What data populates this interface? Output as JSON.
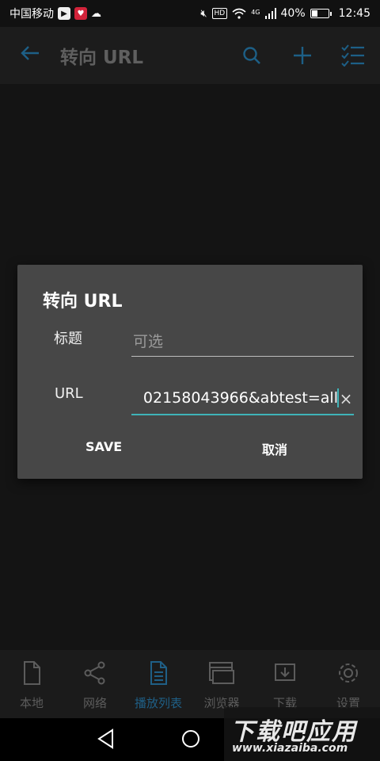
{
  "status_bar": {
    "carrier": "中国移动",
    "network": "4G",
    "battery_percent": "40%",
    "battery_level": 0.4,
    "time": "12:45",
    "hd": "HD"
  },
  "toolbar": {
    "title": "转向 URL"
  },
  "dialog": {
    "title": "转向 URL",
    "title_label": "标题",
    "title_placeholder": "可选",
    "url_label": "URL",
    "url_value": "02158043966&abtest=all",
    "save_label": "SAVE",
    "cancel_label": "取消",
    "clear_icon": "×"
  },
  "bottom_nav": {
    "items": [
      {
        "label": "本地",
        "icon": "file-icon"
      },
      {
        "label": "网络",
        "icon": "share-icon"
      },
      {
        "label": "播放列表",
        "icon": "playlist-icon"
      },
      {
        "label": "浏览器",
        "icon": "browser-icon"
      },
      {
        "label": "下载",
        "icon": "download-icon"
      },
      {
        "label": "设置",
        "icon": "gear-icon"
      }
    ],
    "active_index": 2
  },
  "watermark": {
    "main": "下载吧应用",
    "sub": "www.xiazaiba.com"
  },
  "colors": {
    "accent": "#3fb3b8",
    "toolbar_icon": "#1d5f86",
    "dialog_bg": "#474747"
  }
}
